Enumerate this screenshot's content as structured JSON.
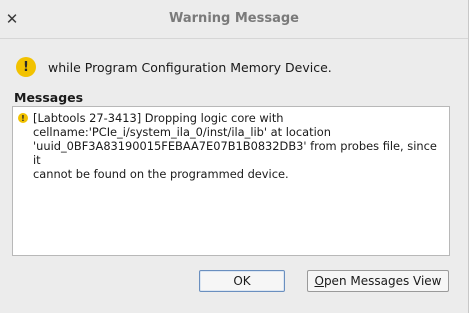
{
  "window": {
    "title": "Warning Message",
    "close_glyph": "✕"
  },
  "header": {
    "icon": "warning-icon",
    "text": "while Program Configuration Memory Device."
  },
  "messages": {
    "label": "Messages",
    "items": [
      {
        "icon": "warning-icon",
        "text": "[Labtools 27-3413] Dropping logic core with\ncellname:'PCIe_i/system_ila_0/inst/ila_lib' at location\n'uuid_0BF3A83190015FEBAA7E07B1B0832DB3' from probes file, since it\ncannot be found on the programmed device."
      }
    ]
  },
  "buttons": {
    "ok_label": "OK",
    "open_messages_view_mnemonic": "O",
    "open_messages_view_rest": "pen Messages View"
  },
  "colors": {
    "warning": "#f2c200",
    "background": "#ececec"
  }
}
